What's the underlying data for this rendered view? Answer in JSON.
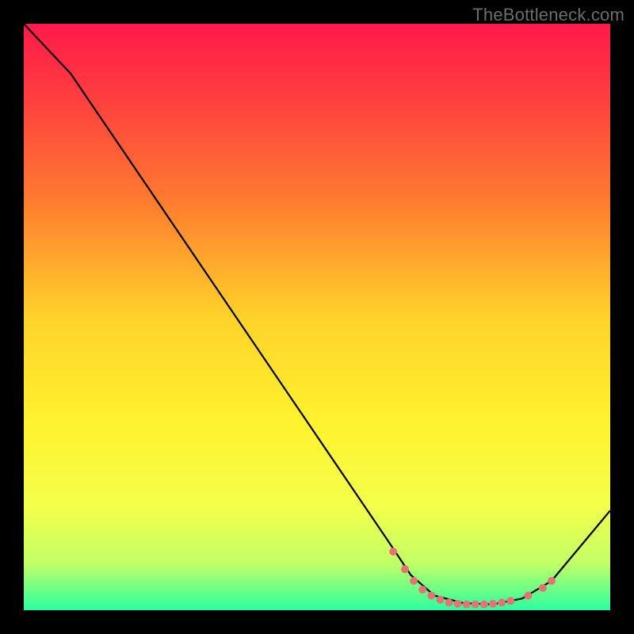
{
  "watermark": "TheBottleneck.com",
  "chart_data": {
    "type": "line",
    "title": "",
    "xlabel": "",
    "ylabel": "",
    "xlim": [
      0,
      100
    ],
    "ylim": [
      0,
      100
    ],
    "background_gradient": {
      "stops": [
        {
          "offset": 0.0,
          "color": "#ff1a4b"
        },
        {
          "offset": 0.12,
          "color": "#ff3c3f"
        },
        {
          "offset": 0.3,
          "color": "#ff7a2f"
        },
        {
          "offset": 0.5,
          "color": "#ffd22a"
        },
        {
          "offset": 0.68,
          "color": "#fff22e"
        },
        {
          "offset": 0.82,
          "color": "#f4ff4a"
        },
        {
          "offset": 0.92,
          "color": "#c2ff66"
        },
        {
          "offset": 0.97,
          "color": "#63ff8a"
        },
        {
          "offset": 1.0,
          "color": "#2dffa0"
        }
      ]
    },
    "series": [
      {
        "name": "curve",
        "color": "#000000",
        "points": [
          {
            "x": 0.0,
            "y": 100.0
          },
          {
            "x": 8.0,
            "y": 91.5
          },
          {
            "x": 62.0,
            "y": 12.0
          },
          {
            "x": 66.0,
            "y": 6.0
          },
          {
            "x": 70.0,
            "y": 2.5
          },
          {
            "x": 75.0,
            "y": 1.2
          },
          {
            "x": 80.0,
            "y": 1.0
          },
          {
            "x": 85.0,
            "y": 2.0
          },
          {
            "x": 90.0,
            "y": 5.0
          },
          {
            "x": 100.0,
            "y": 17.0
          }
        ]
      }
    ],
    "markers": {
      "color": "#e57373",
      "radius": 5,
      "points": [
        {
          "x": 63.0,
          "y": 10.0
        },
        {
          "x": 65.0,
          "y": 7.0
        },
        {
          "x": 66.5,
          "y": 5.0
        },
        {
          "x": 68.0,
          "y": 3.5
        },
        {
          "x": 69.5,
          "y": 2.5
        },
        {
          "x": 71.0,
          "y": 1.8
        },
        {
          "x": 72.5,
          "y": 1.3
        },
        {
          "x": 74.0,
          "y": 1.1
        },
        {
          "x": 75.5,
          "y": 1.0
        },
        {
          "x": 77.0,
          "y": 1.0
        },
        {
          "x": 78.5,
          "y": 1.0
        },
        {
          "x": 80.0,
          "y": 1.1
        },
        {
          "x": 81.5,
          "y": 1.3
        },
        {
          "x": 83.0,
          "y": 1.6
        },
        {
          "x": 86.0,
          "y": 2.5
        },
        {
          "x": 88.5,
          "y": 3.8
        },
        {
          "x": 90.0,
          "y": 5.0
        }
      ]
    }
  }
}
